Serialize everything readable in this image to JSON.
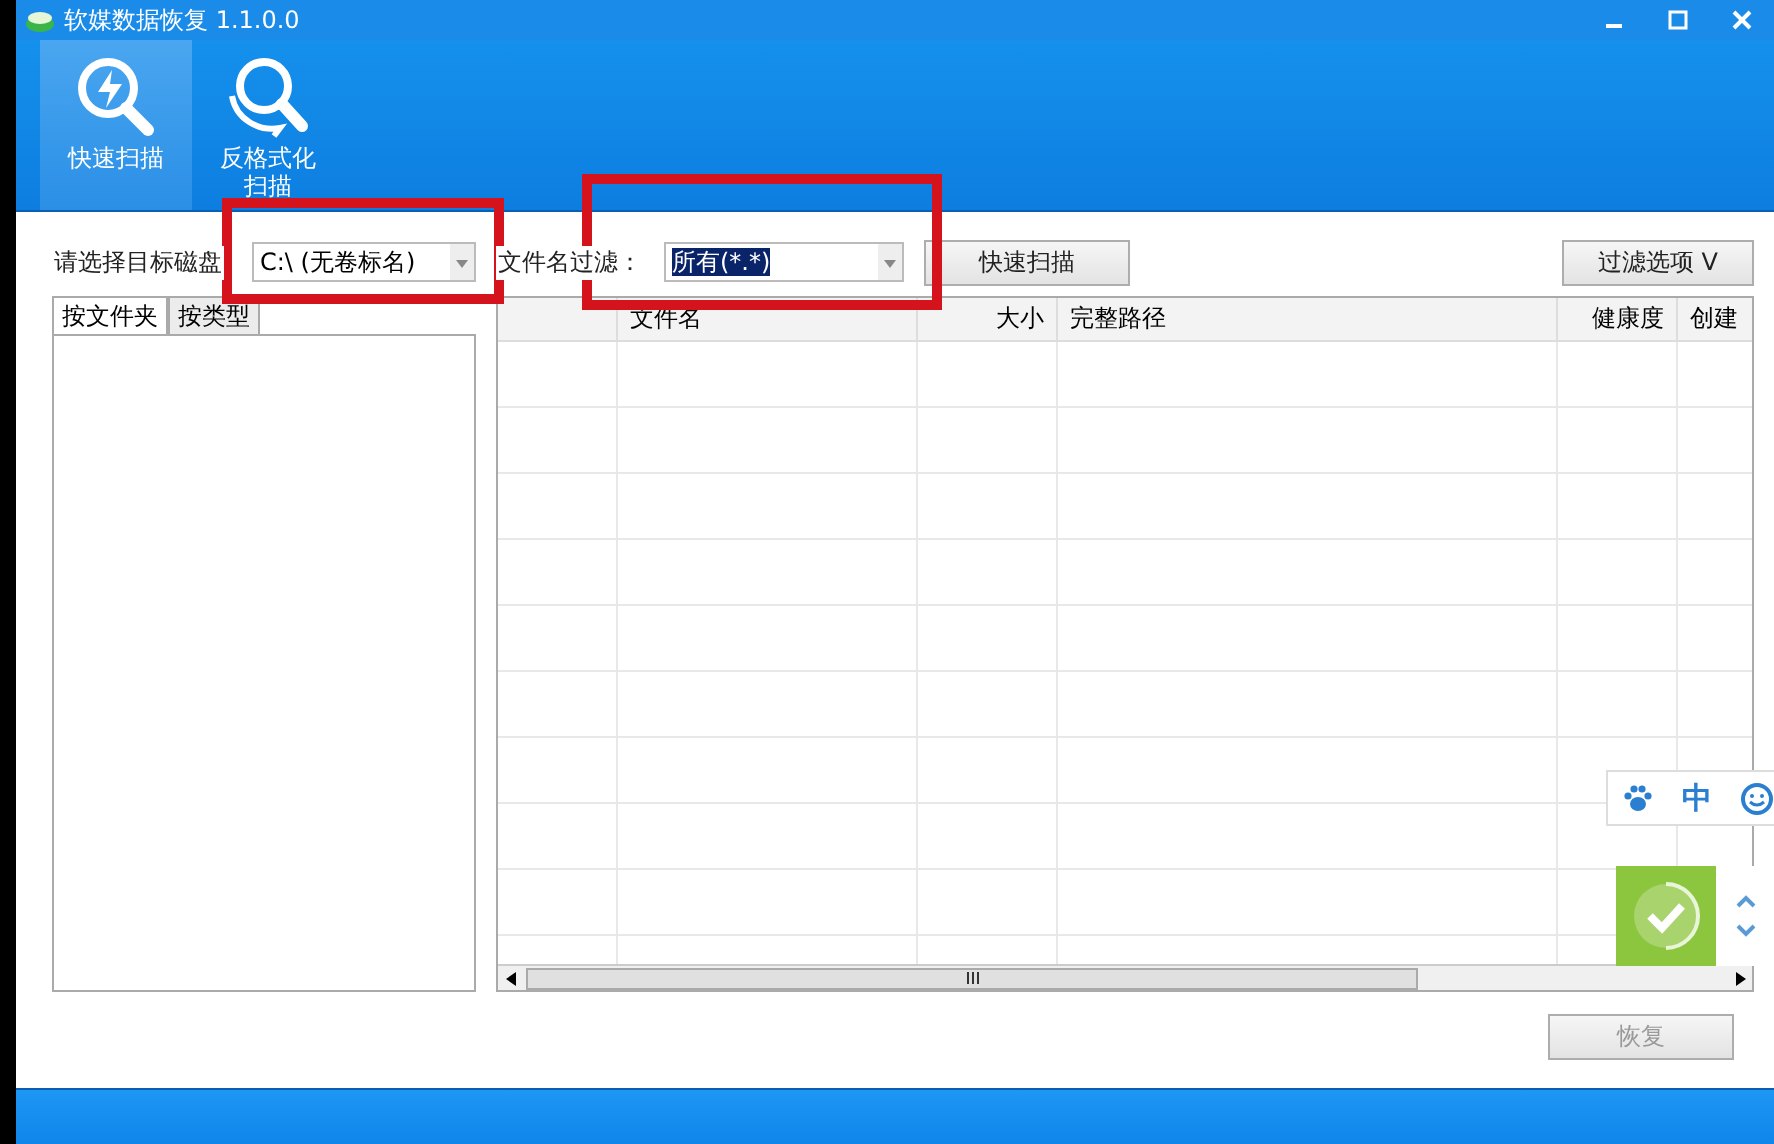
{
  "window": {
    "title": "软媒数据恢复 1.1.0.0"
  },
  "toolbar": [
    {
      "label": "快速扫描",
      "selected": true,
      "kind": "bolt"
    },
    {
      "label": "反格式化扫描",
      "selected": false,
      "kind": "undo"
    }
  ],
  "disk": {
    "label": "请选择目标磁盘",
    "value": "C:\\ (无卷标名)"
  },
  "filter": {
    "label": "文件名过滤：",
    "value": "所有(*.*)"
  },
  "scan_button": "快速扫描",
  "filter_options_button": "过滤选项 V",
  "left_tabs": [
    {
      "label": "按文件夹",
      "selected": true
    },
    {
      "label": "按类型",
      "selected": false
    }
  ],
  "table": {
    "columns": [
      "",
      "文件名",
      "大小",
      "完整路径",
      "健康度",
      "创建"
    ]
  },
  "recover_button": {
    "label": "恢复",
    "disabled": true
  },
  "ime_bar": {
    "mode": "中"
  }
}
